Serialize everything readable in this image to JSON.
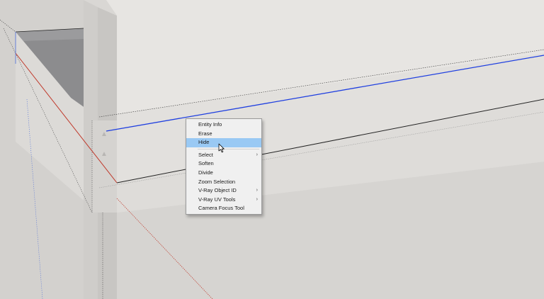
{
  "context_menu": {
    "items": [
      {
        "label": "Entity Info"
      },
      {
        "label": "Erase"
      },
      {
        "label": "Hide"
      },
      {
        "label": "Select",
        "submenu_arrow": "›"
      },
      {
        "label": "Soften"
      },
      {
        "label": "Divide"
      },
      {
        "label": "Zoom Selection"
      },
      {
        "label": "V-Ray Object ID",
        "submenu_arrow": "›"
      },
      {
        "label": "V-Ray UV Tools",
        "submenu_arrow": "›"
      },
      {
        "label": "Camera Focus Tool"
      }
    ],
    "highlighted_item": "Hide",
    "highlight_color": "#99c9f4"
  },
  "scene": {
    "selection_edge_color": "#1f3fe0",
    "red_axis_color": "#c0392b",
    "blue_axis_color": "#4b6cd8"
  }
}
